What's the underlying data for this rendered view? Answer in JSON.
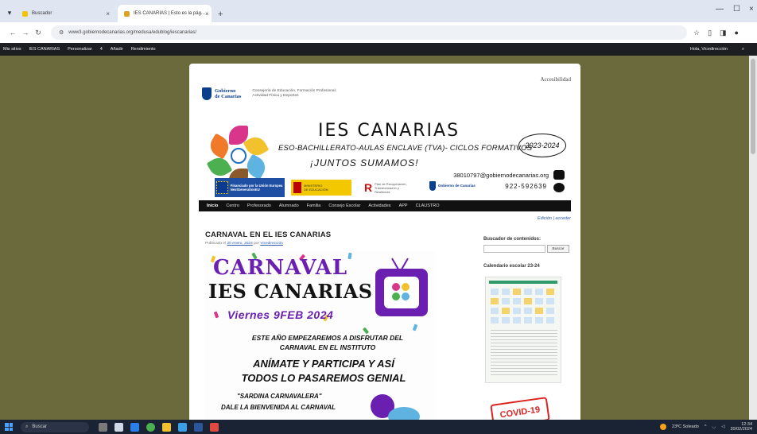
{
  "browser": {
    "tabs": [
      {
        "title": "Buscador"
      },
      {
        "title": "IES CANARIAS | Esto es la pág...",
        "active": true
      }
    ],
    "url": "www3.gobiernodecanarias.org/medusa/edublog/iescanarias/",
    "bookmarks": [
      "Mis sitios",
      "IES CANARIAS",
      "Personalizar",
      "4",
      "Añadir",
      "Rendimiento"
    ],
    "greeting": "Hola, Vicedirección"
  },
  "site": {
    "accessibility": "Accesibilidad",
    "logo": {
      "line1": "Gobierno",
      "line2": "de Canarias"
    },
    "department": "Consejería de Educación, Formación Profesional, Actividad Física y Deportes",
    "banner": {
      "title": "IES CANARIAS",
      "subtitle": "ESO-BACHILLERATO-AULAS ENCLAVE (TVA)- CICLOS FORMATIVOS",
      "slogan": "¡JUNTOS SUMAMOS!",
      "years": "2023-2024",
      "email": "38010797@gobiernodecanarias.org",
      "phone": "922-592639",
      "eu_text": "Financiado por la Unión Europea NextGenerationEU",
      "prtr_text": "Plan de Recuperación, Transformación y Resiliencia",
      "gc_text": "Gobierno de Canarias"
    },
    "menu": [
      "Inicio",
      "Centro",
      "Profesorado",
      "Alumnado",
      "Familia",
      "Consejo Escolar",
      "Actividades",
      "APP",
      "CLAUSTRO"
    ],
    "edit_links": "Edición | acceder",
    "post": {
      "title": "CARNAVAL EN EL IES CANARIAS",
      "meta_prefix": "Publicado el",
      "date": "20 enero, 2024",
      "by": "por",
      "author": "Vicedirección"
    },
    "poster": {
      "carnaval": "CARNAVAL",
      "ies": "IES CANARIAS",
      "date": "Viernes 9FEB 2024",
      "line1": "ESTE AÑO EMPEZAREMOS A DISFRUTAR DEL",
      "line2": "CARNAVAL EN EL INSTITUTO",
      "line3": "ANÍMATE Y PARTICIPA Y ASÍ",
      "line4": "TODOS LO PASAREMOS GENIAL",
      "line5": "\"SARDINA CARNAVALERA\"",
      "line6": "DALE LA BIENVENIDA AL CARNAVAL"
    },
    "sidebar": {
      "search_heading": "Buscador de contenidos:",
      "search_button": "Buscar",
      "calendar_heading": "Calendario escolar 23-24",
      "covid": "COVID-19"
    }
  },
  "taskbar": {
    "search_placeholder": "Buscar",
    "weather": "23ºC Soleado",
    "time": "12:34",
    "date": "20/02/2024"
  }
}
